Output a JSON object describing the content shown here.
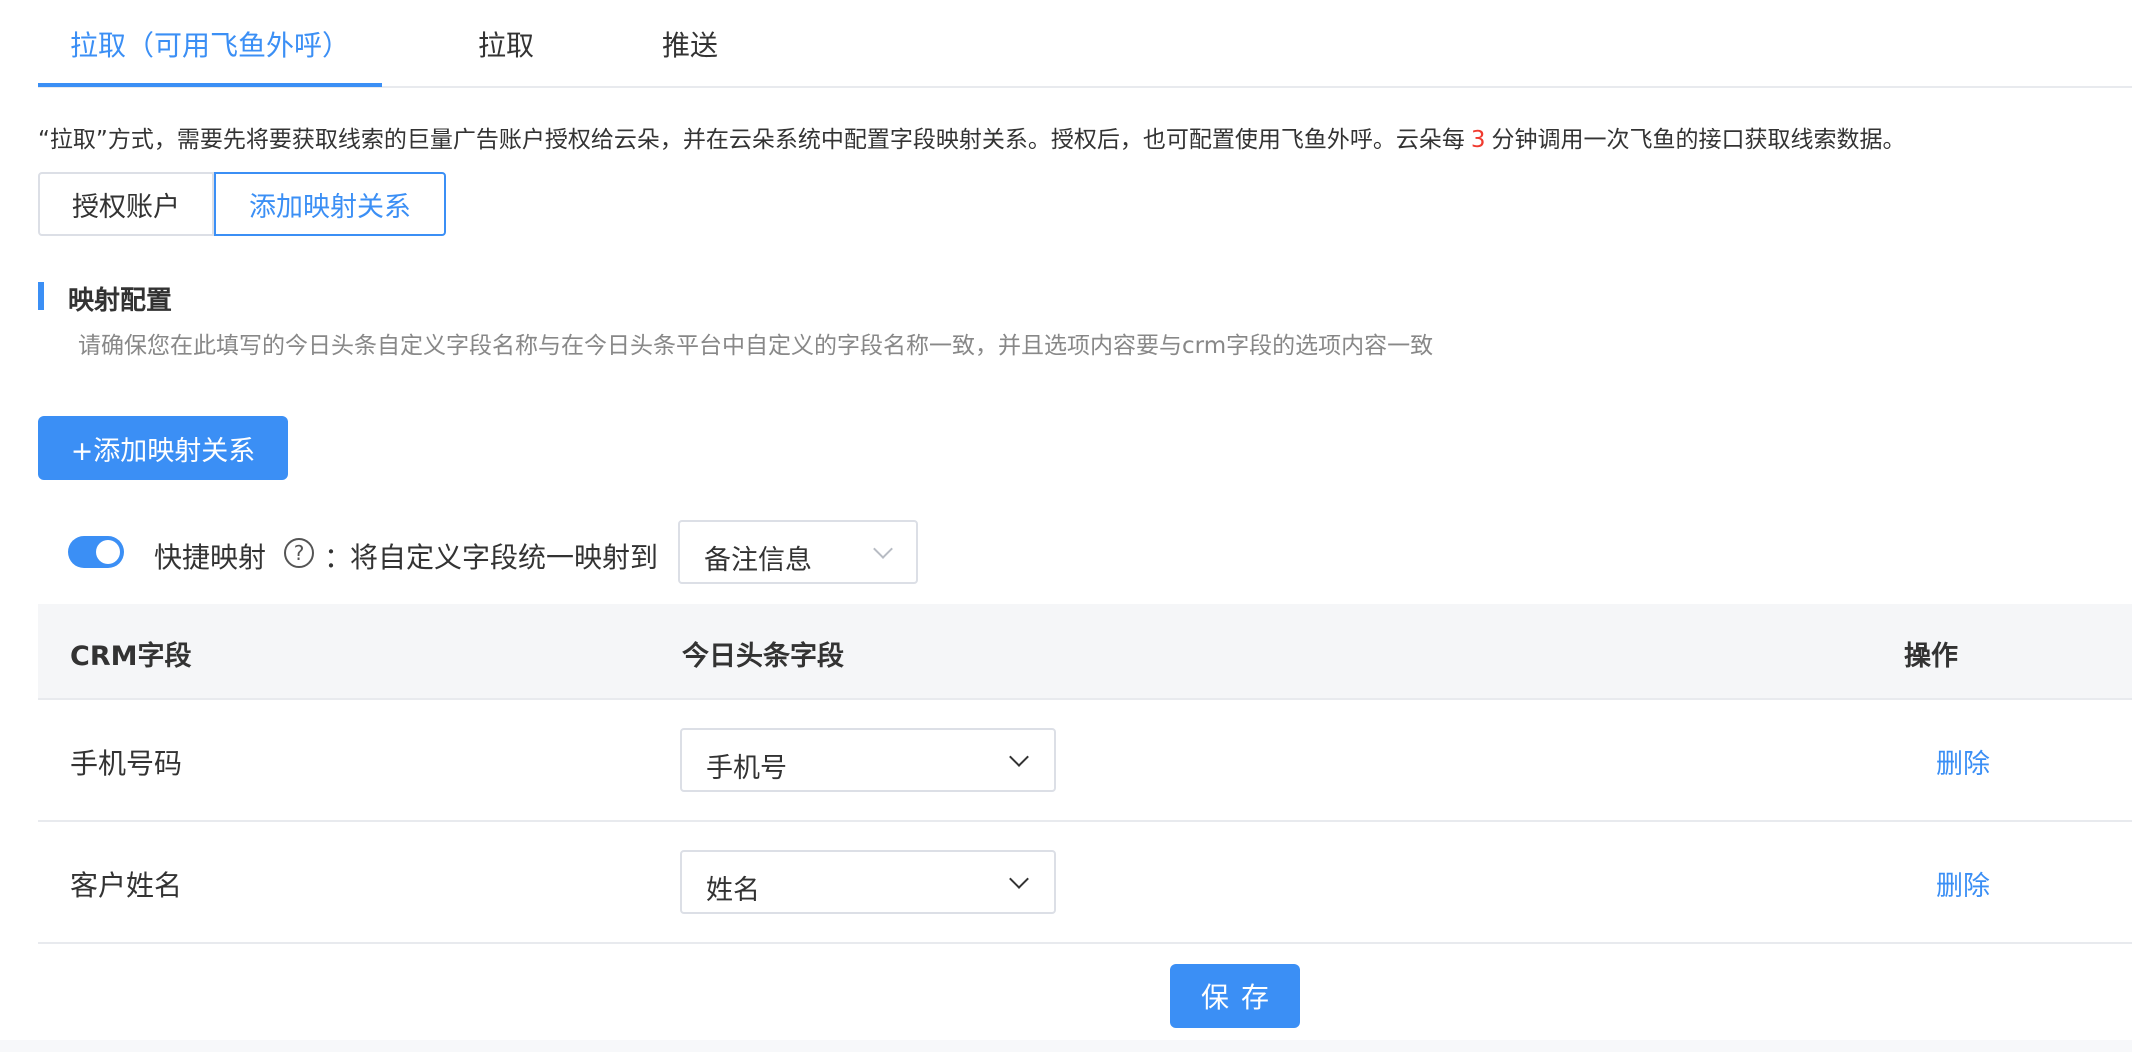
{
  "tabs": [
    {
      "label": "拉取（可用飞鱼外呼）",
      "active": true
    },
    {
      "label": "拉取",
      "active": false
    },
    {
      "label": "推送",
      "active": false
    }
  ],
  "description": {
    "before": "“拉取”方式，需要先将要获取线索的巨量广告账户授权给云朵，并在云朵系统中配置字段映射关系。授权后，也可配置使用飞鱼外呼。云朵每",
    "minutes": "3",
    "after": "分钟调用一次飞鱼的接口获取线索数据。"
  },
  "segmented": {
    "authorize": "授权账户",
    "add_mapping": "添加映射关系",
    "selected": "添加映射关系"
  },
  "section": {
    "title": "映射配置",
    "subtitle": "请确保您在此填写的今日头条自定义字段名称与在今日头条平台中自定义的字段名称一致，并且选项内容要与crm字段的选项内容一致"
  },
  "add_button": "+添加映射关系",
  "quick_map": {
    "enabled": true,
    "label": "快捷映射",
    "help_icon": "question-circle-icon",
    "help_glyph": "?",
    "colon": "：",
    "description": "将自定义字段统一映射到",
    "target_value": "备注信息"
  },
  "table": {
    "headers": {
      "crm": "CRM字段",
      "toutiao": "今日头条字段",
      "action": "操作"
    },
    "rows": [
      {
        "crm": "手机号码",
        "toutiao": "手机号",
        "action": "删除"
      },
      {
        "crm": "客户姓名",
        "toutiao": "姓名",
        "action": "删除"
      }
    ]
  },
  "save_button": "保存",
  "colors": {
    "accent": "#3b8ff5",
    "highlight": "#f03a2f",
    "border": "#dcdfe6",
    "header_bg": "#f5f6f8"
  }
}
